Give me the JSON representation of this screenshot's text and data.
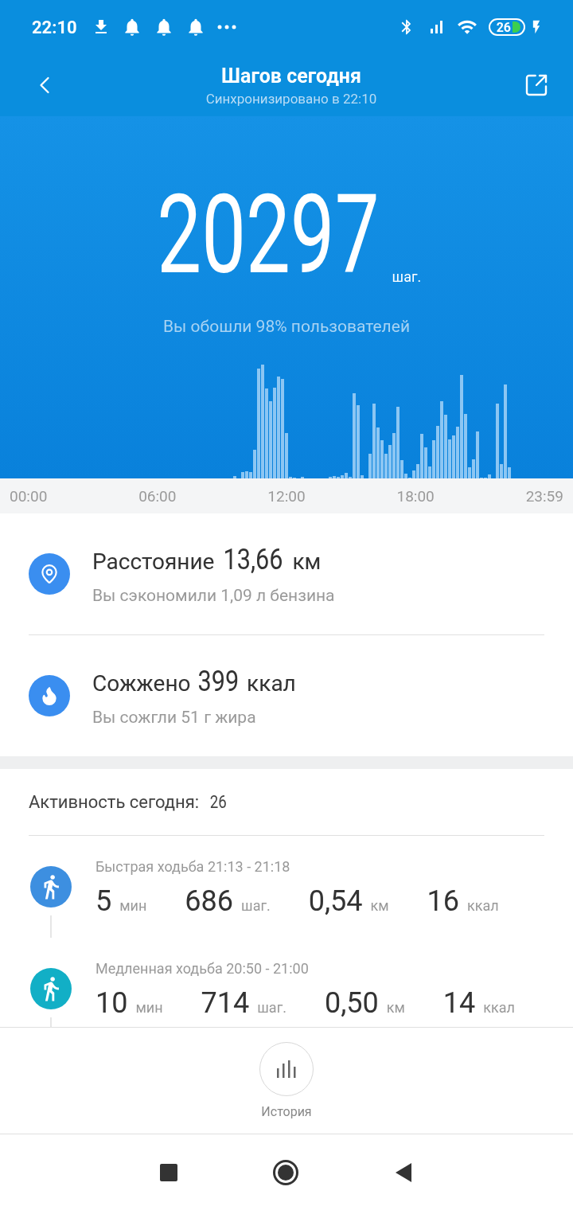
{
  "status_bar": {
    "time": "22:10",
    "battery": "26"
  },
  "header": {
    "title": "Шагов сегодня",
    "subtitle": "Синхронизировано в 22:10"
  },
  "steps": {
    "count": "20297",
    "unit": "шаг.",
    "comparison": "Вы обошли 98% пользователей"
  },
  "chart_axis": [
    "00:00",
    "06:00",
    "12:00",
    "18:00",
    "23:59"
  ],
  "summary": [
    {
      "kind": "distance",
      "label": "Расстояние",
      "value": "13,66",
      "unit": "км",
      "note": "Вы сэкономили 1,09 л бензина"
    },
    {
      "kind": "calories",
      "label": "Сожжено",
      "value": "399",
      "unit": "ккал",
      "note": "Вы сожгли 51 г жира"
    }
  ],
  "activity": {
    "label": "Активность сегодня:",
    "count": "26",
    "items": [
      {
        "title": "Быстрая ходьба 21:13 - 21:18",
        "color": "#3d8fe0",
        "stats": [
          {
            "value": "5",
            "unit": "мин"
          },
          {
            "value": "686",
            "unit": "шаг."
          },
          {
            "value": "0,54",
            "unit": "км"
          },
          {
            "value": "16",
            "unit": "ккал"
          }
        ]
      },
      {
        "title": "Медленная ходьба 20:50 - 21:00",
        "color": "#12afc6",
        "stats": [
          {
            "value": "10",
            "unit": "мин"
          },
          {
            "value": "714",
            "unit": "шаг."
          },
          {
            "value": "0,50",
            "unit": "км"
          },
          {
            "value": "14",
            "unit": "ккал"
          }
        ]
      }
    ]
  },
  "bottom": {
    "history_label": "История"
  }
}
